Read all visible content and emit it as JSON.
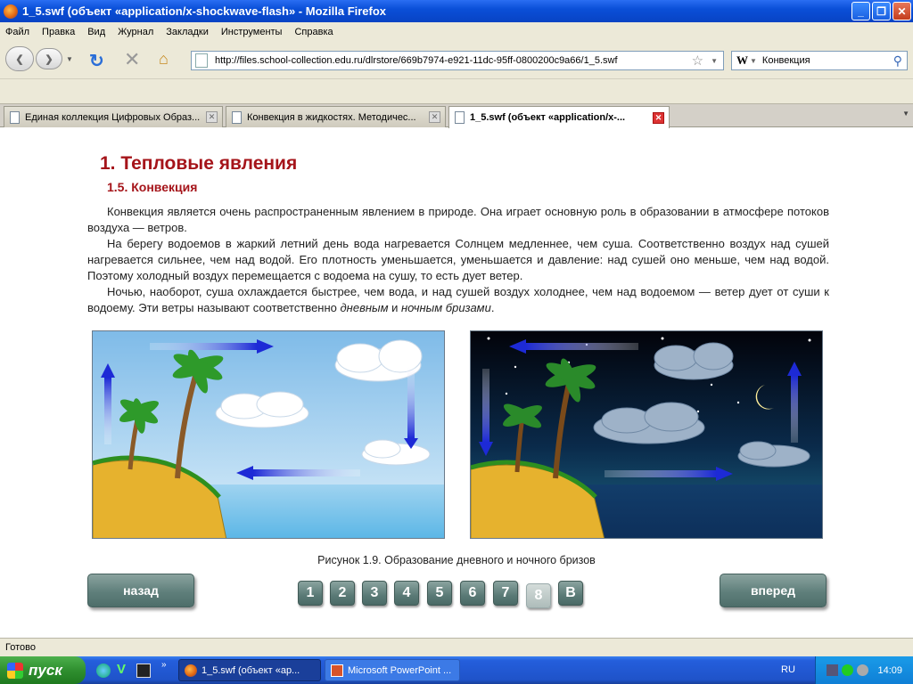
{
  "window": {
    "title": "1_5.swf (объект «application/x-shockwave-flash» - Mozilla Firefox"
  },
  "menu": [
    "Файл",
    "Правка",
    "Вид",
    "Журнал",
    "Закладки",
    "Инструменты",
    "Справка"
  ],
  "nav": {
    "url": "http://files.school-collection.edu.ru/dlrstore/669b7974-e921-11dc-95ff-0800200c9a66/1_5.swf",
    "search_value": "Конвекция",
    "search_engine_icon": "W"
  },
  "tabs": [
    {
      "label": "Единая коллекция Цифровых Образ...",
      "active": false
    },
    {
      "label": "Конвекция в жидкостях. Методичес...",
      "active": false
    },
    {
      "label": "1_5.swf (объект «application/x-...",
      "active": true
    }
  ],
  "page": {
    "heading": "1. Тепловые явления",
    "subheading": "1.5. Конвекция",
    "p1": "Конвекция является очень распространенным явлением в природе. Она играет основную роль в образовании в атмосфере потоков воздуха — ветров.",
    "p2": "На берегу водоемов в жаркий летний день вода нагревается Солнцем медленнее, чем суша. Соответственно воздух над сушей нагревается сильнее, чем над водой. Его плотность уменьшается, уменьшается и давление: над сушей оно меньше, чем над водой. Поэтому холодный воздух перемещается с водоема на сушу, то есть дует ветер.",
    "p3_pre": "Ночью, наоборот, суша охлаждается быстрее, чем вода, и над сушей воздух холоднее, чем над водоемом — ветер дует от суши к водоему. Эти ветры называют соответственно ",
    "p3_em1": "дневным",
    "p3_mid": " и ",
    "p3_em2": "ночным бризами",
    "p3_end": ".",
    "caption": "Рисунок 1.9. Образование дневного и ночного бризов",
    "back_label": "назад",
    "forward_label": "вперед",
    "pages": [
      "1",
      "2",
      "3",
      "4",
      "5",
      "6",
      "7",
      "8",
      "В"
    ],
    "current_page": "8"
  },
  "status": "Готово",
  "taskbar": {
    "start_label": "пуск",
    "tasks": [
      "1_5.swf (объект «ap...",
      "Microsoft PowerPoint ..."
    ],
    "lang": "RU",
    "clock": "14:09"
  },
  "colors": {
    "heading": "#a5141a",
    "button": "#5f7f7b",
    "titlebar": "#0a4fd8"
  }
}
